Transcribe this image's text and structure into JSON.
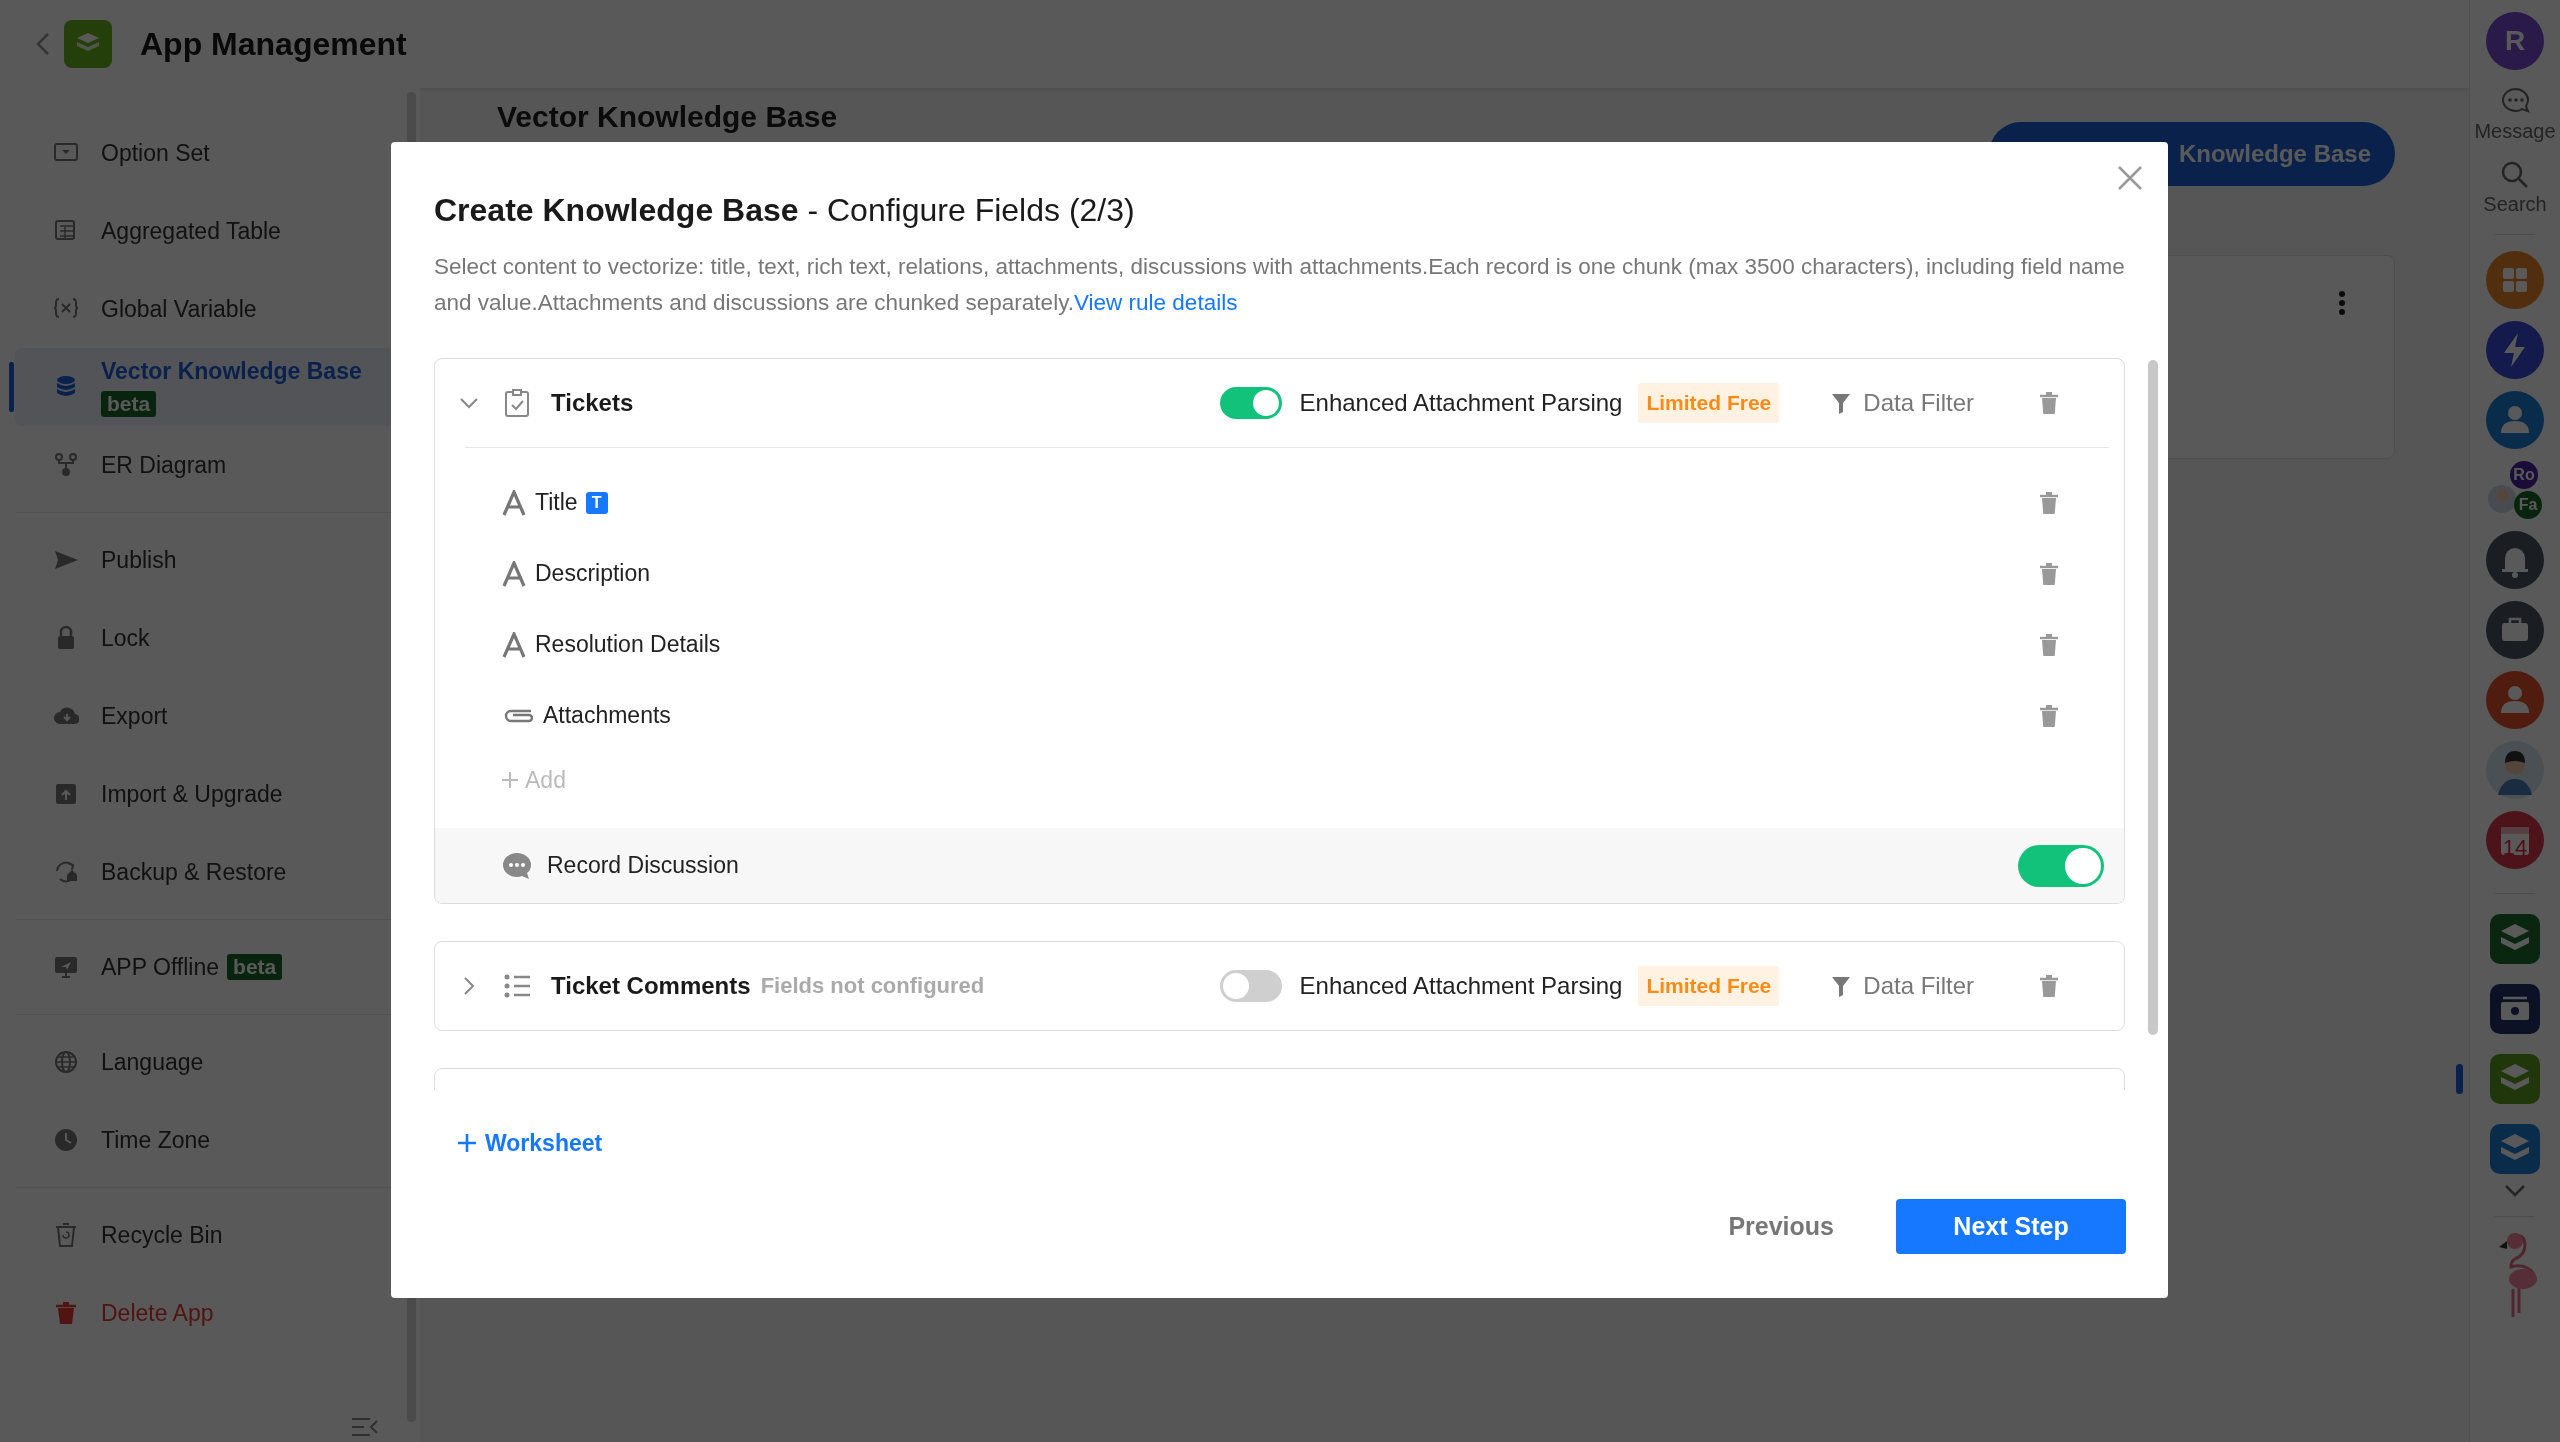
{
  "header": {
    "title": "App Management"
  },
  "sidebar": {
    "groups": [
      [
        {
          "label": "Option Set",
          "selected": false,
          "kind": "normal"
        },
        {
          "label": "Aggregated Table",
          "selected": false,
          "kind": "normal"
        },
        {
          "label": "Global Variable",
          "selected": false,
          "kind": "normal"
        },
        {
          "label": "Vector Knowledge Base",
          "selected": true,
          "kind": "normal",
          "badge": "beta"
        },
        {
          "label": "ER Diagram",
          "selected": false,
          "kind": "normal"
        }
      ],
      [
        {
          "label": "Publish",
          "selected": false,
          "kind": "normal"
        },
        {
          "label": "Lock",
          "selected": false,
          "kind": "normal"
        },
        {
          "label": "Export",
          "selected": false,
          "kind": "normal"
        },
        {
          "label": "Import & Upgrade",
          "selected": false,
          "kind": "normal"
        },
        {
          "label": "Backup & Restore",
          "selected": false,
          "kind": "normal"
        }
      ],
      [
        {
          "label": "APP Offline",
          "selected": false,
          "kind": "normal",
          "badge": "beta"
        }
      ],
      [
        {
          "label": "Language",
          "selected": false,
          "kind": "normal"
        },
        {
          "label": "Time Zone",
          "selected": false,
          "kind": "normal"
        }
      ],
      [
        {
          "label": "Recycle Bin",
          "selected": false,
          "kind": "normal"
        },
        {
          "label": "Delete App",
          "selected": false,
          "kind": "danger"
        }
      ]
    ]
  },
  "page": {
    "title": "Vector Knowledge Base",
    "create_button": "Knowledge Base"
  },
  "rail": {
    "avatar": "R",
    "tools": [
      {
        "label": "Message",
        "kind": "message"
      },
      {
        "label": "Search",
        "kind": "search"
      }
    ],
    "apps": [
      {
        "kind": "grid"
      },
      {
        "kind": "bolt"
      },
      {
        "kind": "team"
      },
      {
        "kind": "group",
        "badges": [
          "Ro",
          "Fa"
        ]
      },
      {
        "kind": "bell"
      },
      {
        "kind": "briefcase"
      },
      {
        "kind": "team-red"
      },
      {
        "kind": "person"
      },
      {
        "kind": "calendar",
        "badge": "14"
      }
    ],
    "workspaces": [
      {
        "kind": "green",
        "selected": false
      },
      {
        "kind": "wallet",
        "selected": false
      },
      {
        "kind": "lime",
        "selected": true
      },
      {
        "kind": "blue",
        "selected": false
      }
    ]
  },
  "modal": {
    "title": "**Create Knowledge Base** - Configure Fields (2/3)",
    "description": "Select content to vectorize: title, text, rich text, relations, attachments, discussions with attachments.Each record is one chunk (max 3500 characters), including field name and value.Attachments and discussions are chunked separately.",
    "link": "View rule details",
    "worksheets": [
      {
        "name": "Tickets",
        "kind": "form",
        "expanded": true,
        "parsing": true,
        "parsing_label": "Enhanced Attachment Parsing",
        "tag": "Limited Free",
        "filter": "Data Filter",
        "fields": [
          {
            "name": "Title",
            "kind": "text",
            "badge": "T"
          },
          {
            "name": "Description",
            "kind": "text"
          },
          {
            "name": "Resolution Details",
            "kind": "text"
          },
          {
            "name": "Attachments",
            "kind": "attachment"
          }
        ],
        "add": "Add",
        "discussion": {
          "label": "Record Discussion",
          "on": true
        }
      },
      {
        "name": "Ticket Comments",
        "kind": "list",
        "expanded": false,
        "note": "Fields not configured",
        "parsing": false,
        "parsing_label": "Enhanced Attachment Parsing",
        "tag": "Limited Free",
        "filter": "Data Filter"
      }
    ],
    "add_worksheet": "Worksheet",
    "previous": "Previous",
    "next": "Next Step"
  }
}
